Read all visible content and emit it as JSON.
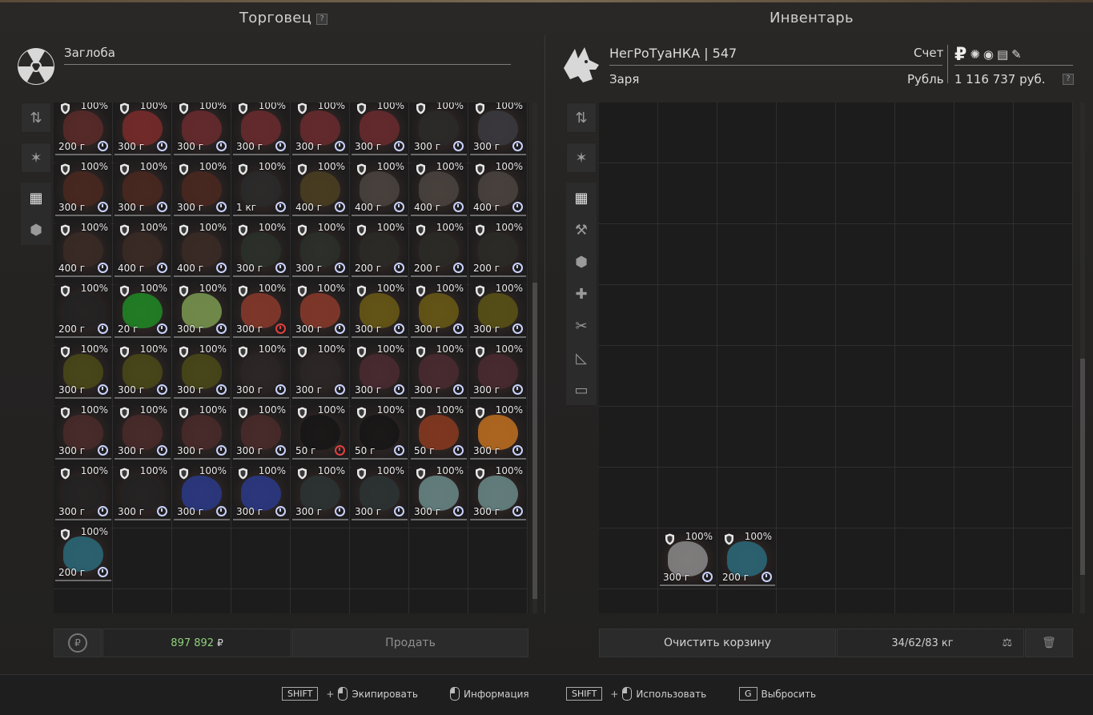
{
  "trader": {
    "title": "Торговец",
    "help": "?",
    "name": "Заглоба",
    "money": "897 892",
    "money_symbol": "₽",
    "sell_label": "Продать",
    "items": [
      {
        "pct": "100%",
        "wt": "200 г",
        "timer": "normal",
        "color": "#5a2a28"
      },
      {
        "pct": "100%",
        "wt": "300 г",
        "timer": "normal",
        "color": "#7a2a2a"
      },
      {
        "pct": "100%",
        "wt": "300 г",
        "timer": "normal",
        "color": "#6a2a2e"
      },
      {
        "pct": "100%",
        "wt": "300 г",
        "timer": "normal",
        "color": "#6a2a2e"
      },
      {
        "pct": "100%",
        "wt": "300 г",
        "timer": "normal",
        "color": "#6a2a2e"
      },
      {
        "pct": "100%",
        "wt": "300 г",
        "timer": "normal",
        "color": "#6a2a2e"
      },
      {
        "pct": "100%",
        "wt": "300 г",
        "timer": "normal",
        "color": "#2a2a28"
      },
      {
        "pct": "100%",
        "wt": "300 г",
        "timer": "normal",
        "color": "#3a3a40"
      },
      {
        "pct": "100%",
        "wt": "300 г",
        "timer": "normal",
        "color": "#4a2820"
      },
      {
        "pct": "100%",
        "wt": "300 г",
        "timer": "normal",
        "color": "#4a2820"
      },
      {
        "pct": "100%",
        "wt": "300 г",
        "timer": "normal",
        "color": "#4a2820"
      },
      {
        "pct": "100%",
        "wt": "1 кг",
        "timer": "normal",
        "color": "#2a2a2a"
      },
      {
        "pct": "100%",
        "wt": "400 г",
        "timer": "normal",
        "color": "#4a4020"
      },
      {
        "pct": "100%",
        "wt": "400 г",
        "timer": "normal",
        "color": "#4a4440"
      },
      {
        "pct": "100%",
        "wt": "400 г",
        "timer": "normal",
        "color": "#4a4440"
      },
      {
        "pct": "100%",
        "wt": "400 г",
        "timer": "normal",
        "color": "#4a4440"
      },
      {
        "pct": "100%",
        "wt": "400 г",
        "timer": "normal",
        "color": "#3a2a24"
      },
      {
        "pct": "100%",
        "wt": "400 г",
        "timer": "normal",
        "color": "#3a2a24"
      },
      {
        "pct": "100%",
        "wt": "400 г",
        "timer": "normal",
        "color": "#3a2a24"
      },
      {
        "pct": "100%",
        "wt": "300 г",
        "timer": "normal",
        "color": "#2a302a"
      },
      {
        "pct": "100%",
        "wt": "300 г",
        "timer": "normal",
        "color": "#2a302a"
      },
      {
        "pct": "100%",
        "wt": "200 г",
        "timer": "normal",
        "color": "#2a2a26"
      },
      {
        "pct": "100%",
        "wt": "200 г",
        "timer": "normal",
        "color": "#2a2a26"
      },
      {
        "pct": "100%",
        "wt": "200 г",
        "timer": "normal",
        "color": "#2a2a26"
      },
      {
        "pct": "100%",
        "wt": "200 г",
        "timer": "normal",
        "color": "#222222"
      },
      {
        "pct": "100%",
        "wt": "20 г",
        "timer": "normal",
        "color": "#1f8a24"
      },
      {
        "pct": "100%",
        "wt": "300 г",
        "timer": "normal",
        "color": "#7a9a50"
      },
      {
        "pct": "100%",
        "wt": "300 г",
        "timer": "red",
        "color": "#8a3a2a"
      },
      {
        "pct": "100%",
        "wt": "300 г",
        "timer": "normal",
        "color": "#8a3a2a"
      },
      {
        "pct": "100%",
        "wt": "300 г",
        "timer": "normal",
        "color": "#6a5a14"
      },
      {
        "pct": "100%",
        "wt": "300 г",
        "timer": "normal",
        "color": "#6a5a14"
      },
      {
        "pct": "100%",
        "wt": "300 г",
        "timer": "normal",
        "color": "#5a5414"
      },
      {
        "pct": "100%",
        "wt": "300 г",
        "timer": "normal",
        "color": "#4a4a18"
      },
      {
        "pct": "100%",
        "wt": "300 г",
        "timer": "normal",
        "color": "#4a4a18"
      },
      {
        "pct": "100%",
        "wt": "300 г",
        "timer": "normal",
        "color": "#4a4a18"
      },
      {
        "pct": "100%",
        "wt": "300 г",
        "timer": "normal",
        "color": "#2a2626"
      },
      {
        "pct": "100%",
        "wt": "300 г",
        "timer": "normal",
        "color": "#2a2626"
      },
      {
        "pct": "100%",
        "wt": "300 г",
        "timer": "normal",
        "color": "#4a2a30"
      },
      {
        "pct": "100%",
        "wt": "300 г",
        "timer": "normal",
        "color": "#4a2a30"
      },
      {
        "pct": "100%",
        "wt": "300 г",
        "timer": "normal",
        "color": "#4a2a30"
      },
      {
        "pct": "100%",
        "wt": "300 г",
        "timer": "normal",
        "color": "#4a2a2a"
      },
      {
        "pct": "100%",
        "wt": "300 г",
        "timer": "normal",
        "color": "#4a2a2a"
      },
      {
        "pct": "100%",
        "wt": "300 г",
        "timer": "normal",
        "color": "#4a2a2a"
      },
      {
        "pct": "100%",
        "wt": "300 г",
        "timer": "normal",
        "color": "#4a2a2a"
      },
      {
        "pct": "100%",
        "wt": "50 г",
        "timer": "red",
        "color": "#151515"
      },
      {
        "pct": "100%",
        "wt": "50 г",
        "timer": "normal",
        "color": "#151515"
      },
      {
        "pct": "100%",
        "wt": "50 г",
        "timer": "normal",
        "color": "#8a3a20"
      },
      {
        "pct": "100%",
        "wt": "300 г",
        "timer": "normal",
        "color": "#c07020"
      },
      {
        "pct": "100%",
        "wt": "300 г",
        "timer": "normal",
        "color": "#222222"
      },
      {
        "pct": "100%",
        "wt": "300 г",
        "timer": "normal",
        "color": "#222222"
      },
      {
        "pct": "100%",
        "wt": "300 г",
        "timer": "normal",
        "color": "#2a3a8a"
      },
      {
        "pct": "100%",
        "wt": "300 г",
        "timer": "normal",
        "color": "#2a3a8a"
      },
      {
        "pct": "100%",
        "wt": "300 г",
        "timer": "normal",
        "color": "#2a3432"
      },
      {
        "pct": "100%",
        "wt": "300 г",
        "timer": "normal",
        "color": "#2a3432"
      },
      {
        "pct": "100%",
        "wt": "300 г",
        "timer": "normal",
        "color": "#6a8a8a"
      },
      {
        "pct": "100%",
        "wt": "300 г",
        "timer": "normal",
        "color": "#6a8a8a"
      },
      {
        "pct": "100%",
        "wt": "200 г",
        "timer": "normal",
        "color": "#2a6a7a"
      }
    ]
  },
  "inventory": {
    "title": "Инвентарь",
    "help": "?",
    "player": "НегРоТуаНКА | 547",
    "faction": "Заря",
    "account_label": "Счет",
    "currency_label": "Рубль",
    "balance": "1 116 737 руб.",
    "clear_label": "Очистить корзину",
    "weight": "34/62/83 кг",
    "items": [
      {
        "pct": "100%",
        "wt": "300 г",
        "timer": "normal",
        "color": "#8a8a8a"
      },
      {
        "pct": "100%",
        "wt": "200 г",
        "timer": "normal",
        "color": "#2a6a7a"
      }
    ]
  },
  "footer": {
    "shift": "SHIFT",
    "equip": "Экипировать",
    "info": "Информация",
    "use": "Использовать",
    "g": "G",
    "drop": "Выбросить",
    "plus": "+"
  }
}
